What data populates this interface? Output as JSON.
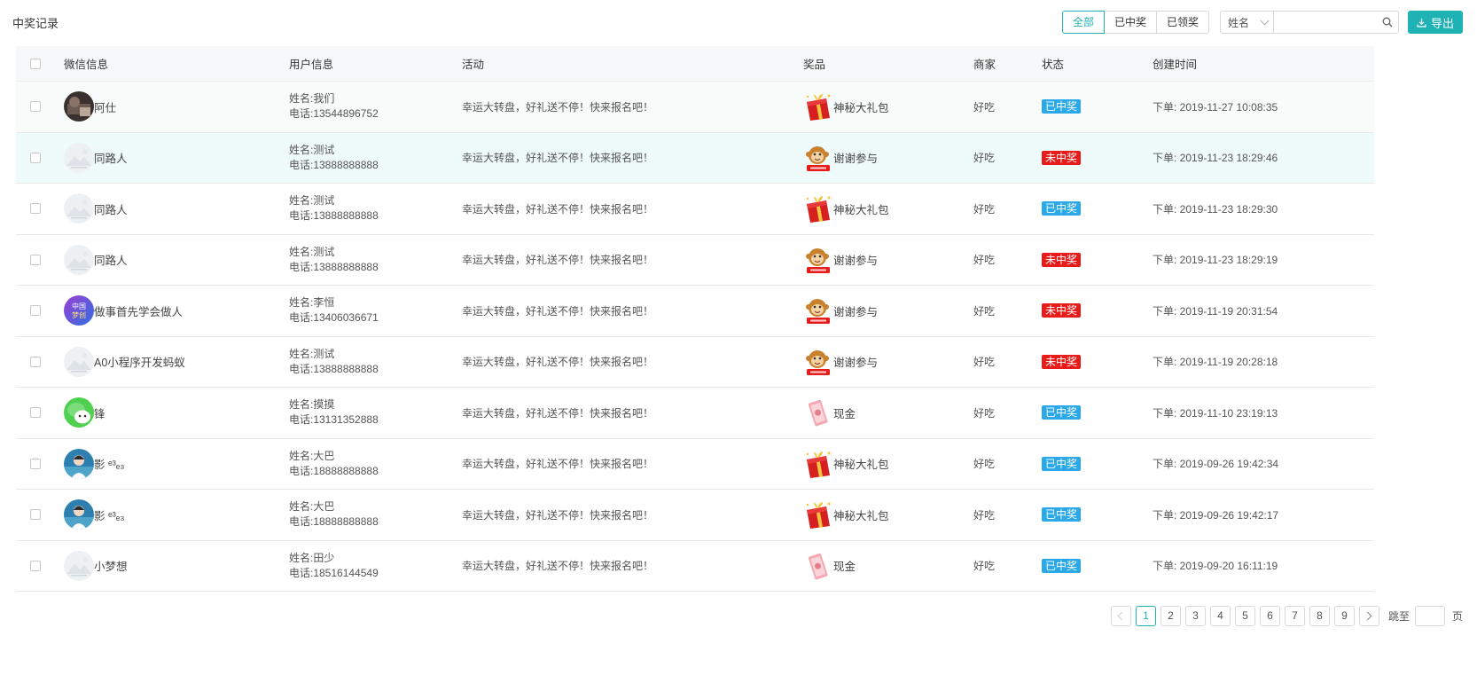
{
  "page": {
    "title": "中奖记录"
  },
  "toolbar": {
    "filters": [
      {
        "label": "全部",
        "active": true
      },
      {
        "label": "已中奖",
        "active": false
      },
      {
        "label": "已领奖",
        "active": false
      }
    ],
    "search": {
      "field": "姓名",
      "placeholder": "",
      "value": ""
    },
    "export_label": "导出"
  },
  "table": {
    "headers": [
      "微信信息",
      "用户信息",
      "活动",
      "奖品",
      "商家",
      "状态",
      "创建时间"
    ],
    "rows": [
      {
        "avatar": "photo",
        "nick": "阿仕",
        "name": "姓名:我们",
        "phone": "电话:13544896752",
        "activity": "幸运大转盘，好礼送不停！快来报名吧！",
        "prize_icon": "gift",
        "prize": "神秘大礼包",
        "shop": "好吃",
        "status": "已中奖",
        "time": "下单: 2019-11-27 10:08:35"
      },
      {
        "avatar": "default",
        "nick": "同路人",
        "name": "姓名:测试",
        "phone": "电话:13888888888",
        "activity": "幸运大转盘，好礼送不停！快来报名吧！",
        "prize_icon": "monkey",
        "prize": "谢谢参与",
        "shop": "好吃",
        "status": "未中奖",
        "time": "下单: 2019-11-23 18:29:46"
      },
      {
        "avatar": "default",
        "nick": "同路人",
        "name": "姓名:测试",
        "phone": "电话:13888888888",
        "activity": "幸运大转盘，好礼送不停！快来报名吧！",
        "prize_icon": "gift",
        "prize": "神秘大礼包",
        "shop": "好吃",
        "status": "已中奖",
        "time": "下单: 2019-11-23 18:29:30"
      },
      {
        "avatar": "default",
        "nick": "同路人",
        "name": "姓名:测试",
        "phone": "电话:13888888888",
        "activity": "幸运大转盘，好礼送不停！快来报名吧！",
        "prize_icon": "monkey",
        "prize": "谢谢参与",
        "shop": "好吃",
        "status": "未中奖",
        "time": "下单: 2019-11-23 18:29:19"
      },
      {
        "avatar": "dream",
        "nick": "做事首先学会做人",
        "name": "姓名:李恒",
        "phone": "电话:13406036671",
        "activity": "幸运大转盘，好礼送不停！快来报名吧！",
        "prize_icon": "monkey",
        "prize": "谢谢参与",
        "shop": "好吃",
        "status": "未中奖",
        "time": "下单: 2019-11-19 20:31:54"
      },
      {
        "avatar": "default",
        "nick": "A0小程序开发蚂蚁",
        "name": "姓名:测试",
        "phone": "电话:13888888888",
        "activity": "幸运大转盘，好礼送不停！快来报名吧！",
        "prize_icon": "monkey",
        "prize": "谢谢参与",
        "shop": "好吃",
        "status": "未中奖",
        "time": "下单: 2019-11-19 20:28:18"
      },
      {
        "avatar": "wechat",
        "nick": "锋",
        "name": "姓名:摸摸",
        "phone": "电话:13131352888",
        "activity": "幸运大转盘，好礼送不停！快来报名吧！",
        "prize_icon": "cash",
        "prize": "现金",
        "shop": "好吃",
        "status": "已中奖",
        "time": "下单: 2019-11-10 23:19:13"
      },
      {
        "avatar": "person",
        "nick": "影 ᵉ³ₑ₃",
        "name": "姓名:大巴",
        "phone": "电话:18888888888",
        "activity": "幸运大转盘，好礼送不停！快来报名吧！",
        "prize_icon": "gift",
        "prize": "神秘大礼包",
        "shop": "好吃",
        "status": "已中奖",
        "time": "下单: 2019-09-26 19:42:34"
      },
      {
        "avatar": "person",
        "nick": "影 ᵉ³ₑ₃",
        "name": "姓名:大巴",
        "phone": "电话:18888888888",
        "activity": "幸运大转盘，好礼送不停！快来报名吧！",
        "prize_icon": "gift",
        "prize": "神秘大礼包",
        "shop": "好吃",
        "status": "已中奖",
        "time": "下单: 2019-09-26 19:42:17"
      },
      {
        "avatar": "default",
        "nick": "小梦想",
        "name": "姓名:田少",
        "phone": "电话:18516144549",
        "activity": "幸运大转盘，好礼送不停！快来报名吧！",
        "prize_icon": "cash",
        "prize": "现金",
        "shop": "好吃",
        "status": "已中奖",
        "time": "下单: 2019-09-20 16:11:19"
      }
    ]
  },
  "pagination": {
    "pages": [
      "1",
      "2",
      "3",
      "4",
      "5",
      "6",
      "7",
      "8",
      "9"
    ],
    "current": "1",
    "jump_label": "跳至",
    "jump_suffix": "页",
    "jump_value": ""
  },
  "colors": {
    "accent": "#1fb2b5",
    "won": "#2aa8e8",
    "lost": "#e81b1b",
    "row_tint_1": "#f7fcfb",
    "row_tint_2": "#effbfa"
  }
}
